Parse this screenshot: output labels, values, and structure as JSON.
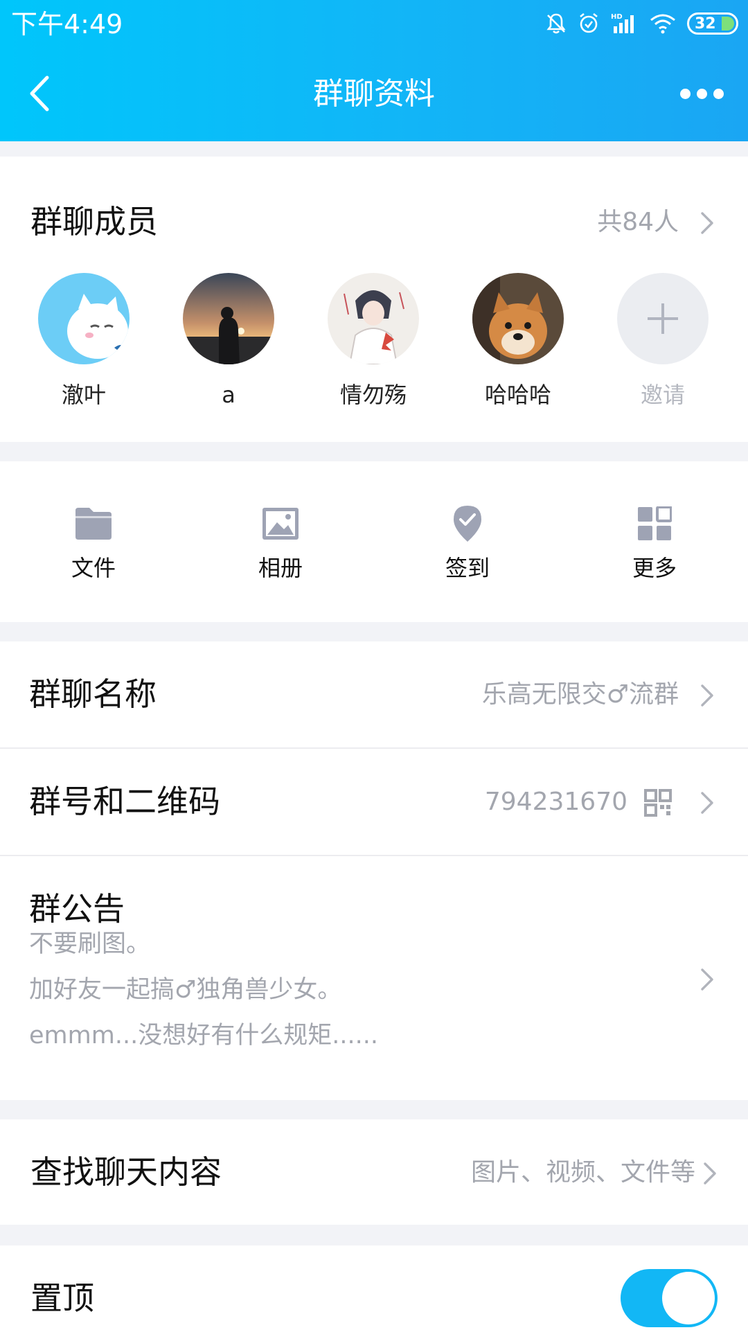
{
  "status_bar": {
    "time": "下午4:49",
    "battery": "32",
    "network_badge": "HD"
  },
  "nav": {
    "title": "群聊资料"
  },
  "members": {
    "title": "群聊成员",
    "count": "共84人",
    "list": [
      {
        "name": "澈叶",
        "avatar": "cat-avatar"
      },
      {
        "name": "a",
        "avatar": "sunset-avatar"
      },
      {
        "name": "情勿殇",
        "avatar": "anime-avatar"
      },
      {
        "name": "哈哈哈",
        "avatar": "dog-avatar"
      }
    ],
    "invite_label": "邀请"
  },
  "quick_actions": [
    {
      "label": "文件",
      "icon": "folder-icon"
    },
    {
      "label": "相册",
      "icon": "photo-icon"
    },
    {
      "label": "签到",
      "icon": "checkin-icon"
    },
    {
      "label": "更多",
      "icon": "grid-icon"
    }
  ],
  "info": {
    "group_name_label": "群聊名称",
    "group_name_value": "乐高无限交♂流群",
    "group_id_label": "群号和二维码",
    "group_id_value": "794231670",
    "notice_label": "群公告",
    "notice_lines": [
      "不要刷图。",
      "加好友一起搞♂独角兽少女。",
      "emmm...没想好有什么规矩......"
    ]
  },
  "search": {
    "label": "查找聊天内容",
    "hint": "图片、视频、文件等"
  },
  "pin": {
    "label": "置顶",
    "enabled": true
  },
  "colors": {
    "header_start": "#00c6fb",
    "header_end": "#1aa6f3",
    "accent": "#12b7f5",
    "muted_text": "#a3a6ae",
    "icon_gray": "#9ea3b4"
  }
}
